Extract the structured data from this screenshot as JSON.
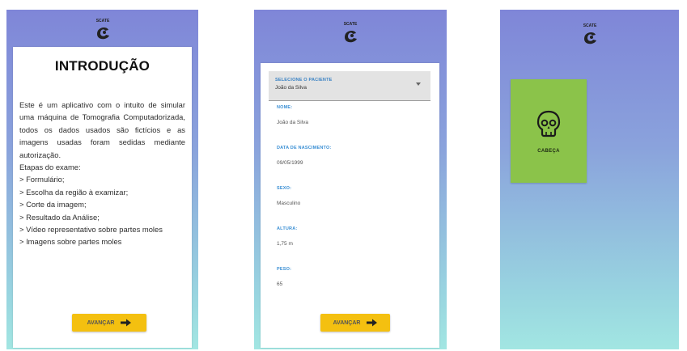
{
  "colors": {
    "bg_top": "#7f86d8",
    "bg_bottom": "#a2e6e2",
    "accent_button": "#f4c010",
    "tile_green": "#8bc34a",
    "field_label_blue": "#3a8fd4"
  },
  "logo": {
    "text": "SCATE",
    "icon": "app-logo-icon"
  },
  "screen1": {
    "title": "INTRODUÇÃO",
    "paragraph": "Este é um aplicativo com o intuito de simular uma máquina de Tomografia Computadorizada, todos os dados usados são fictícios e as imagens usadas foram sedidas mediante autorização.",
    "steps_title": "Etapas do exame:",
    "steps": [
      "> Formulário;",
      "> Escolha da região à examizar;",
      "> Corte da imagem;",
      "> Resultado da Análise;",
      "> Vídeo representativo sobre partes moles",
      "> Imagens sobre partes moles"
    ],
    "button_label": "AVANÇAR",
    "button_icon": "arrow-right-icon"
  },
  "screen2": {
    "select": {
      "label": "SELECIONE O PACIENTE",
      "value": "João da Silva"
    },
    "fields": [
      {
        "label": "NOME:",
        "value": "João da Silva"
      },
      {
        "label": "DATA DE NASCIMENTO:",
        "value": "09/05/1999"
      },
      {
        "label": "SEXO:",
        "value": "Masculino"
      },
      {
        "label": "ALTURA:",
        "value": "1,75 m"
      },
      {
        "label": "PESO:",
        "value": "65"
      }
    ],
    "button_label": "AVANÇAR",
    "button_icon": "arrow-right-icon"
  },
  "screen3": {
    "regions": [
      {
        "label": "CABEÇA",
        "icon": "skull-icon"
      }
    ]
  }
}
